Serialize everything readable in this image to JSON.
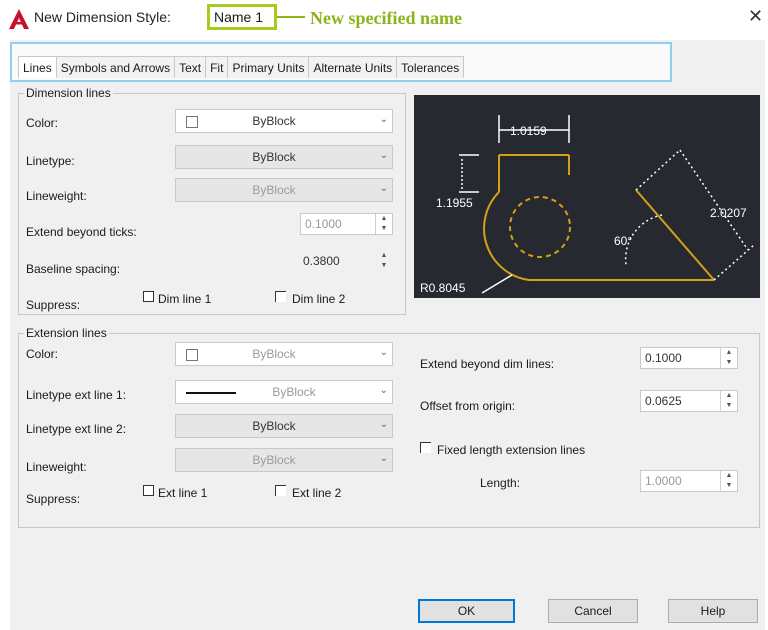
{
  "window": {
    "title": "New Dimension Style:",
    "style_name": "Name 1",
    "annotation": "New specified name",
    "close_glyph": "✕"
  },
  "tabs": [
    "Lines",
    "Symbols and Arrows",
    "Text",
    "Fit",
    "Primary Units",
    "Alternate Units",
    "Tolerances"
  ],
  "dimension_lines": {
    "group_label": "Dimension lines",
    "color": {
      "label": "Color:",
      "value": "ByBlock"
    },
    "linetype": {
      "label": "Linetype:",
      "value": "ByBlock"
    },
    "lineweight": {
      "label": "Lineweight:",
      "value": "ByBlock"
    },
    "extend_beyond_ticks": {
      "label": "Extend beyond ticks:",
      "value": "0.1000"
    },
    "baseline_spacing": {
      "label": "Baseline spacing:",
      "value": "0.3800"
    },
    "suppress": {
      "label": "Suppress:",
      "dim_line_1": "Dim line 1",
      "dim_line_2": "Dim line 2"
    }
  },
  "extension_lines": {
    "group_label": "Extension lines",
    "color": {
      "label": "Color:",
      "value": "ByBlock"
    },
    "linetype_ext1": {
      "label": "Linetype ext line 1:",
      "value": "ByBlock"
    },
    "linetype_ext2": {
      "label": "Linetype ext line 2:",
      "value": "ByBlock"
    },
    "lineweight": {
      "label": "Lineweight:",
      "value": "ByBlock"
    },
    "suppress": {
      "label": "Suppress:",
      "ext_line_1": "Ext line 1",
      "ext_line_2": "Ext line 2"
    },
    "extend_beyond_dim": {
      "label": "Extend beyond dim lines:",
      "value": "0.1000"
    },
    "offset_from_origin": {
      "label": "Offset from origin:",
      "value": "0.0625"
    },
    "fixed_length": {
      "label": "Fixed length extension lines",
      "checked": false
    },
    "length": {
      "label": "Length:",
      "value": "1.0000"
    }
  },
  "preview": {
    "dim_top": "1.0159",
    "dim_left": "1.1955",
    "dim_right": "2.0207",
    "angle": "60°",
    "radius": "R0.8045"
  },
  "buttons": {
    "ok": "OK",
    "cancel": "Cancel",
    "help": "Help"
  },
  "colors": {
    "annotation_green": "#8db31a",
    "tab_highlight": "#8fd0ea",
    "preview_bg": "#262930",
    "preview_geometry": "#d4a017",
    "app_icon_red": "#c8102e"
  }
}
